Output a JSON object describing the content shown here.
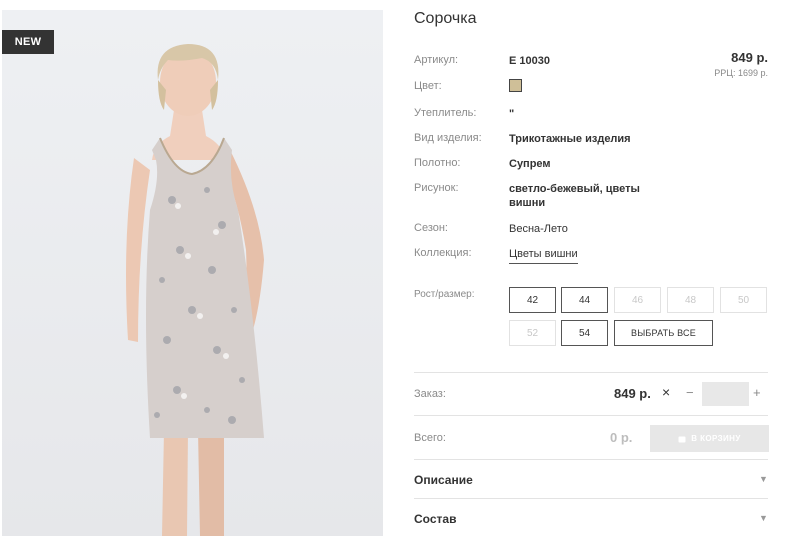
{
  "badge": "NEW",
  "product": {
    "title": "Сорочка",
    "price": "849 р.",
    "rrp": "PPЦ: 1699 р."
  },
  "attributes": [
    {
      "label": "Артикул:",
      "value": "E 10030",
      "style": "bold"
    },
    {
      "label": "Цвет:",
      "swatch_color": "#cfbf98"
    },
    {
      "label": "Утеплитель:",
      "value": "\"",
      "style": "bold"
    },
    {
      "label": "Вид изделия:",
      "value": "Трикотажные изделия",
      "style": "bold"
    },
    {
      "label": "Полотно:",
      "value": "Супрем",
      "style": "bold"
    },
    {
      "label": "Рисунок:",
      "value": "светло-бежевый, цветы вишни",
      "style": "bold"
    },
    {
      "label": "Сезон:",
      "value": "Весна-Лето",
      "style": "normal"
    },
    {
      "label": "Коллекция:",
      "value": "Цветы вишни",
      "style": "link"
    }
  ],
  "sizes": {
    "label": "Рост/размер:",
    "items": [
      {
        "label": "42",
        "available": true
      },
      {
        "label": "44",
        "available": true
      },
      {
        "label": "46",
        "available": false
      },
      {
        "label": "48",
        "available": false
      },
      {
        "label": "50",
        "available": false
      },
      {
        "label": "52",
        "available": false
      },
      {
        "label": "54",
        "available": true
      }
    ],
    "select_all": "ВЫБРАТЬ ВСЕ"
  },
  "order": {
    "label": "Заказ:",
    "price": "849 р.",
    "times": "×",
    "minus": "−",
    "plus": "+",
    "quantity": ""
  },
  "total": {
    "label": "Всего:",
    "value": "0 р.",
    "cart_button": "В КОРЗИНУ"
  },
  "accordion": [
    {
      "label": "Описание"
    },
    {
      "label": "Состав"
    }
  ]
}
